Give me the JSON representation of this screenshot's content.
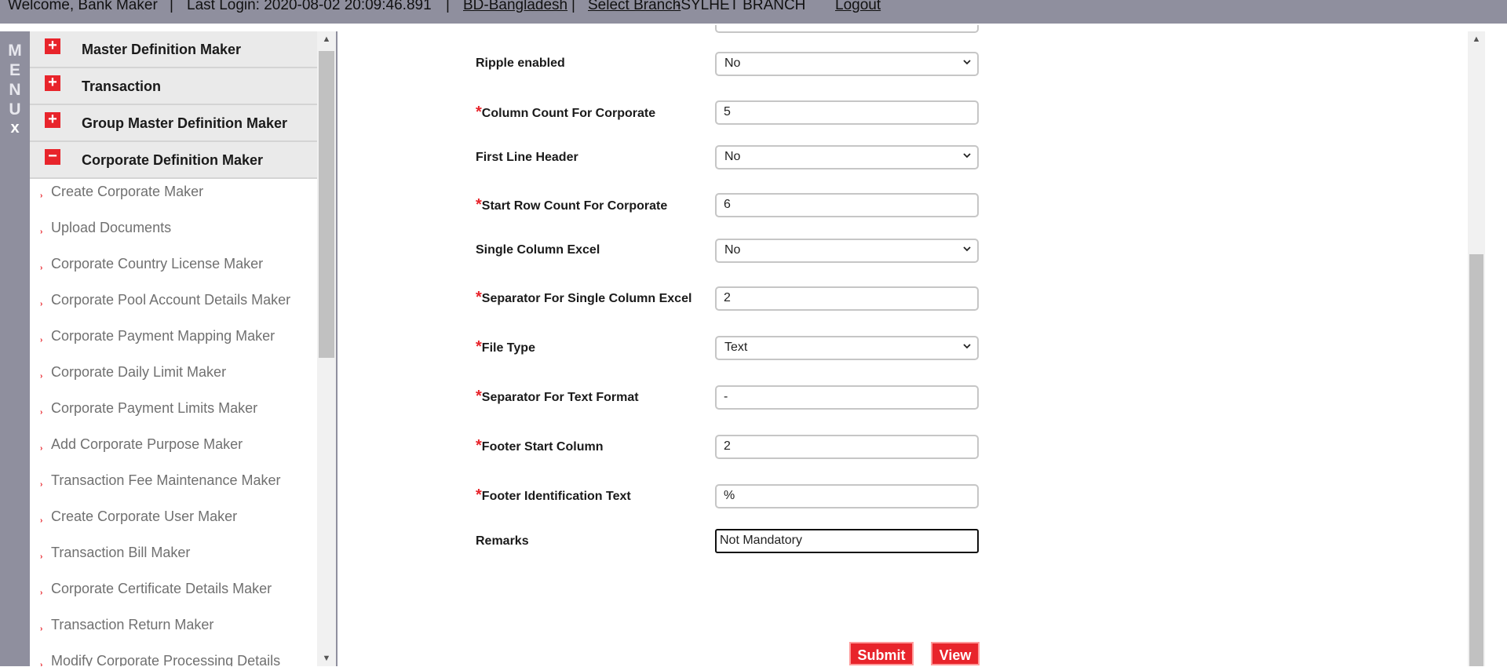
{
  "topbar": {
    "welcome": "Welcome, Bank Maker",
    "last_login": "Last Login: 2020-08-02 20:09:46.891",
    "country": "BD-Bangladesh",
    "select_branch": "Select Branch",
    "branch": "-SYLHET BRANCH",
    "logout": "Logout",
    "separator": "|"
  },
  "menu_strip": {
    "letters": [
      "M",
      "E",
      "N",
      "U"
    ],
    "close": "x"
  },
  "menu": {
    "sections": [
      {
        "label": "Master Definition Maker",
        "expanded": false,
        "icon": "plus-icon"
      },
      {
        "label": "Transaction",
        "expanded": false,
        "icon": "plus-icon"
      },
      {
        "label": "Group Master Definition Maker",
        "expanded": false,
        "icon": "plus-icon"
      },
      {
        "label": "Corporate Definition Maker",
        "expanded": true,
        "icon": "minus-icon"
      }
    ],
    "expanded_items": [
      "Create Corporate Maker",
      "Upload Documents",
      "Corporate Country License Maker",
      "Corporate Pool Account Details Maker",
      "Corporate Payment Mapping Maker",
      "Corporate Daily Limit Maker",
      "Corporate Payment Limits Maker",
      "Add Corporate Purpose Maker",
      "Transaction Fee Maintenance Maker",
      "Create Corporate User Maker",
      "Transaction Bill Maker",
      "Corporate Certificate Details Maker",
      "Transaction Return Maker",
      "Modify Corporate Processing Details"
    ],
    "plus_glyph": "+",
    "minus_glyph": "−",
    "arrow_glyph": "›"
  },
  "form": {
    "required_mark": "*",
    "fields": [
      {
        "label": "Ripple enabled",
        "required": false,
        "type": "select",
        "value": "No"
      },
      {
        "label": "Column Count For Corporate",
        "required": true,
        "type": "input",
        "value": "5"
      },
      {
        "label": "First Line Header",
        "required": false,
        "type": "select",
        "value": "No"
      },
      {
        "label": "Start Row Count For Corporate",
        "required": true,
        "type": "input",
        "value": "6"
      },
      {
        "label": "Single Column Excel",
        "required": false,
        "type": "select",
        "value": "No"
      },
      {
        "label": "Separator For Single Column Excel",
        "required": true,
        "type": "input",
        "value": "2"
      },
      {
        "label": "File Type",
        "required": true,
        "type": "select",
        "value": "Text"
      },
      {
        "label": "Separator For Text Format",
        "required": true,
        "type": "input",
        "value": "-"
      },
      {
        "label": "Footer Start Column",
        "required": true,
        "type": "input",
        "value": "2"
      },
      {
        "label": "Footer Identification Text",
        "required": true,
        "type": "input",
        "value": "%"
      },
      {
        "label": "Remarks",
        "required": false,
        "type": "input",
        "value": "Not Mandatory"
      }
    ],
    "submit_label": "Submit",
    "view_label": "View"
  },
  "colors": {
    "accent": "#e8242b",
    "bar": "#8f8f9e"
  }
}
